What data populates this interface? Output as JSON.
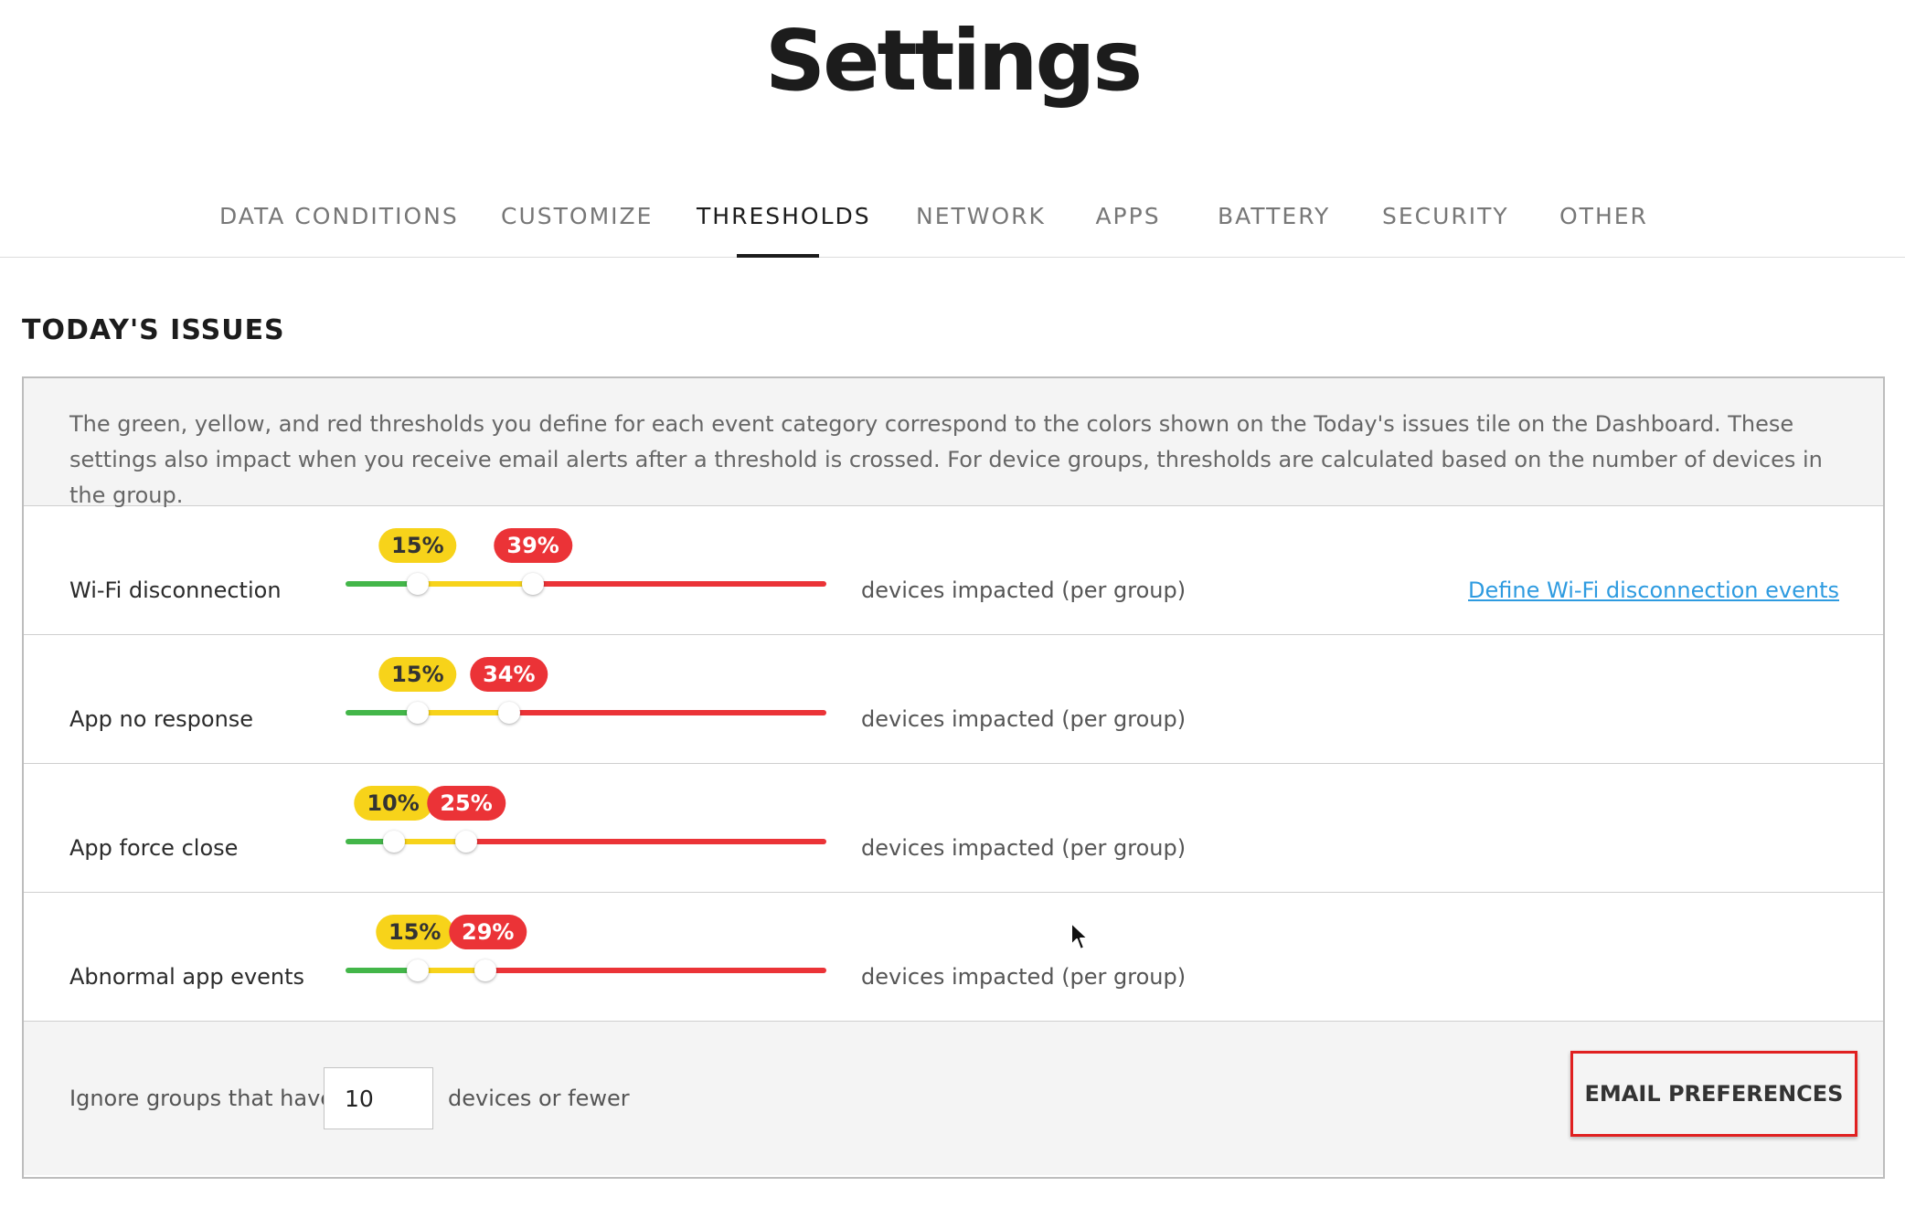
{
  "page": {
    "title": "Settings"
  },
  "tabs": [
    {
      "label": "DATA CONDITIONS",
      "active": false
    },
    {
      "label": "CUSTOMIZE",
      "active": false
    },
    {
      "label": "THRESHOLDS",
      "active": true
    },
    {
      "label": "NETWORK",
      "active": false
    },
    {
      "label": "APPS",
      "active": false
    },
    {
      "label": "BATTERY",
      "active": false
    },
    {
      "label": "SECURITY",
      "active": false
    },
    {
      "label": "OTHER",
      "active": false
    }
  ],
  "section": {
    "title": "TODAY'S ISSUES",
    "description": "The green, yellow, and red thresholds you define for each event category correspond to the colors shown on the Today's issues tile on the Dashboard. These settings also impact when you receive email alerts after a threshold is crossed. For device groups, thresholds are calculated based on the number of devices in the group."
  },
  "thresholds": [
    {
      "label": "Wi-Fi disconnection",
      "yellow": 15,
      "red": 39,
      "yellow_label": "15%",
      "red_label": "39%",
      "unit": "devices impacted (per group)",
      "link": "Define Wi-Fi disconnection events"
    },
    {
      "label": "App no response",
      "yellow": 15,
      "red": 34,
      "yellow_label": "15%",
      "red_label": "34%",
      "unit": "devices impacted (per group)"
    },
    {
      "label": "App force close",
      "yellow": 10,
      "red": 25,
      "yellow_label": "10%",
      "red_label": "25%",
      "unit": "devices impacted (per group)"
    },
    {
      "label": "Abnormal app events",
      "yellow": 15,
      "red": 29,
      "yellow_label": "15%",
      "red_label": "29%",
      "unit": "devices impacted (per group)"
    }
  ],
  "footer": {
    "ignore_label": "Ignore groups that have",
    "ignore_value": "10",
    "ignore_suffix": "devices or fewer",
    "email_button": "EMAIL PREFERENCES"
  },
  "colors": {
    "green": "#43b649",
    "yellow": "#f7d31a",
    "red": "#eb3337",
    "link": "#2e9be0",
    "highlight": "#e02020"
  },
  "icons": {
    "cursor": "mouse-pointer-icon"
  }
}
